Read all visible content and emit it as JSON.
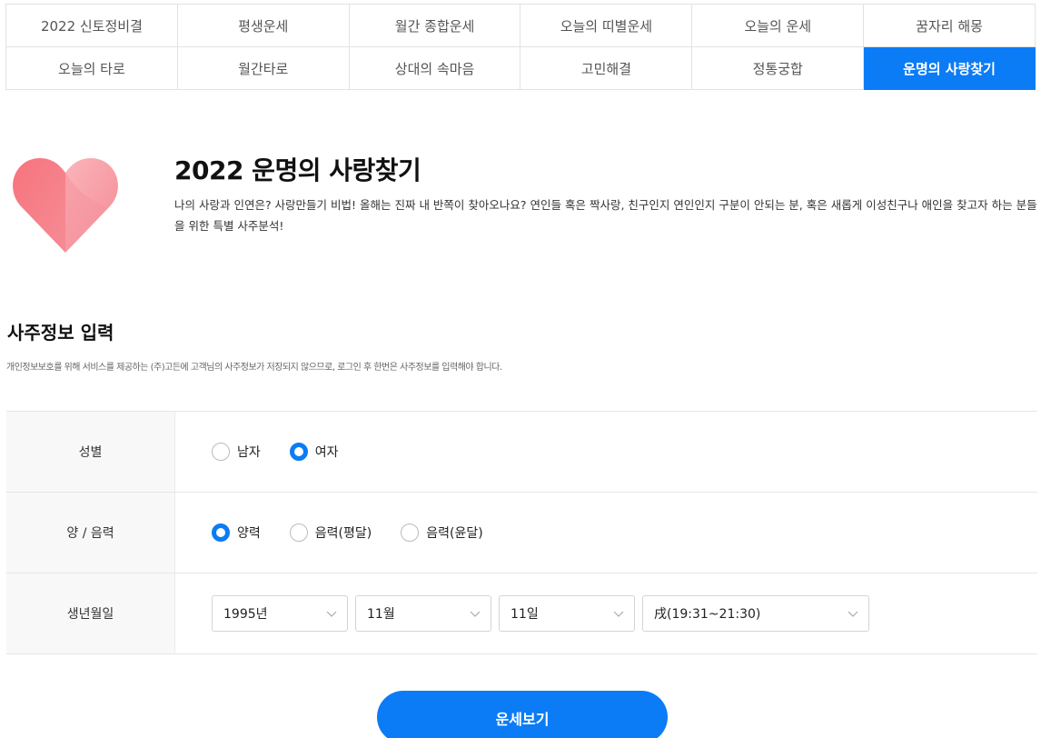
{
  "tabs": {
    "row1": [
      "2022 신토정비결",
      "평생운세",
      "월간 종합운세",
      "오늘의 띠별운세",
      "오늘의 운세",
      "꿈자리 해몽"
    ],
    "row2": [
      "오늘의 타로",
      "월간타로",
      "상대의 속마음",
      "고민해결",
      "정통궁합",
      "운명의 사랑찾기"
    ],
    "active": "운명의 사랑찾기"
  },
  "intro": {
    "title": "2022 운명의 사랑찾기",
    "description": "나의 사랑과 인연은? 사랑만들기 비법! 올해는 진짜 내 반쪽이 찾아오나요? 연인들 혹은 짝사랑, 친구인지 연인인지 구분이 안되는 분, 혹은 새롭게 이성친구나 애인을 찾고자 하는 분들을 위한 특별 사주분석!",
    "icon": "heart-icon"
  },
  "section": {
    "title": "사주정보 입력",
    "note": "개인정보보호를 위해 서비스를 제공하는 (주)고든에 고객님의 사주정보가 저장되지 않으므로, 로그인 후 한번은 사주정보를 입력해야 합니다."
  },
  "form": {
    "gender": {
      "label": "성별",
      "options": [
        "남자",
        "여자"
      ],
      "selected": "여자"
    },
    "calendar": {
      "label": "양 / 음력",
      "options": [
        "양력",
        "음력(평달)",
        "음력(윤달)"
      ],
      "selected": "양력"
    },
    "birth": {
      "label": "생년월일",
      "year": "1995년",
      "month": "11월",
      "day": "11일",
      "time": "戌(19:31~21:30)"
    }
  },
  "submit_label": "운세보기",
  "colors": {
    "accent": "#0b7cf6",
    "heart_top": "#f9a0a8",
    "heart_bottom": "#f2707c"
  }
}
